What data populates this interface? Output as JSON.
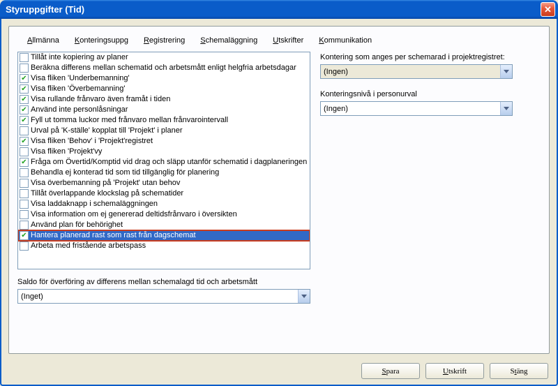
{
  "window": {
    "title": "Styruppgifter (Tid)"
  },
  "tabs": {
    "t0": {
      "u": "A",
      "rest": "llmänna"
    },
    "t1": {
      "u": "K",
      "rest": "onteringsuppg"
    },
    "t2": {
      "u": "R",
      "rest": "egistrering"
    },
    "t3": {
      "u": "S",
      "rest": "chemaläggning"
    },
    "t4": {
      "u": "U",
      "rest": "tskrifter"
    },
    "t5": {
      "u": "K",
      "rest": "ommunikation"
    }
  },
  "options": [
    {
      "label": "Tillåt inte kopiering av planer",
      "checked": false
    },
    {
      "label": "Beräkna differens mellan schematid och arbetsmått enligt helgfria arbetsdagar",
      "checked": false
    },
    {
      "label": "Visa fliken 'Underbemanning'",
      "checked": true
    },
    {
      "label": "Visa fliken 'Överbemanning'",
      "checked": true
    },
    {
      "label": "Visa rullande frånvaro även framåt i tiden",
      "checked": true
    },
    {
      "label": "Använd inte personlåsningar",
      "checked": true
    },
    {
      "label": "Fyll ut tomma luckor med frånvaro mellan frånvarointervall",
      "checked": true
    },
    {
      "label": "Urval på 'K-ställe' kopplat till 'Projekt' i planer",
      "checked": false
    },
    {
      "label": "Visa fliken 'Behov' i 'Projekt'registret",
      "checked": true
    },
    {
      "label": "Visa fliken 'Projekt'vy",
      "checked": false
    },
    {
      "label": "Fråga om Övertid/Komptid vid drag och släpp utanför schematid i dagplaneringen",
      "checked": true
    },
    {
      "label": "Behandla ej konterad tid som tid tillgänglig för planering",
      "checked": false
    },
    {
      "label": "Visa överbemanning på 'Projekt' utan behov",
      "checked": false
    },
    {
      "label": "Tillåt överlappande klockslag på schematider",
      "checked": false
    },
    {
      "label": "Visa laddaknapp i schemaläggningen",
      "checked": false
    },
    {
      "label": "Visa information om ej genererad deltidsfrånvaro i översikten",
      "checked": false
    },
    {
      "label": "Använd plan för behörighet",
      "checked": false
    },
    {
      "label": "Hantera planerad rast som rast från dagschemat",
      "checked": true,
      "highlighted": true
    },
    {
      "label": "Arbeta med fristående arbetspass",
      "checked": false
    }
  ],
  "right": {
    "konteringLabel": "Kontering som anges per schemarad i projektregistret:",
    "konteringVal": "(Ingen)",
    "nivaLabel": "Konteringsnivå i personurval",
    "nivaVal": "(Ingen)"
  },
  "saldo": {
    "label": "Saldo för överföring av differens mellan schemalagd tid och arbetsmått",
    "value": "(Inget)"
  },
  "buttons": {
    "save": {
      "u": "S",
      "rest": "para"
    },
    "print": {
      "u": "U",
      "rest": "tskrift"
    },
    "close": {
      "pre": "S",
      "u": "t",
      "rest": "äng"
    }
  }
}
